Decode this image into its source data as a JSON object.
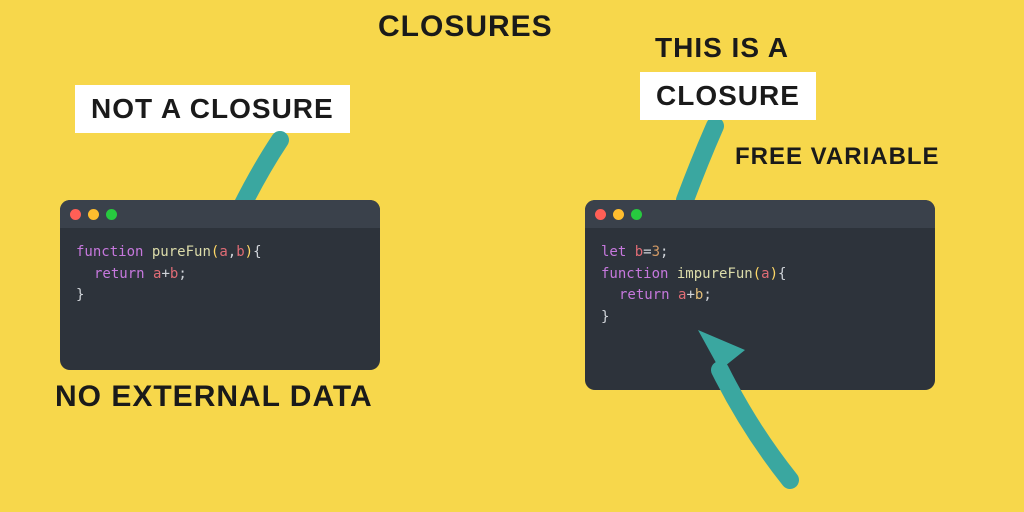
{
  "title": "CLOSURES",
  "left": {
    "label": "NOT A CLOSURE",
    "caption": "NO EXTERNAL DATA",
    "code": {
      "line1_kw": "function",
      "line1_fn": "pureFun",
      "line1_paren_open": "(",
      "line1_args_a": "a",
      "line1_args_comma": ",",
      "line1_args_b": "b",
      "line1_paren_close": ")",
      "line1_brace": "{",
      "line2_kw": "return",
      "line2_a": "a",
      "line2_plus": "+",
      "line2_b": "b",
      "line2_semi": ";",
      "line3_brace": "}"
    }
  },
  "right": {
    "label_top": "THIS IS A",
    "label_bottom": "CLOSURE",
    "caption": "FREE VARIABLE",
    "code": {
      "line1_kw": "let",
      "line1_var": "b",
      "line1_eq": "=",
      "line1_num": "3",
      "line1_semi": ";",
      "line2_kw": "function",
      "line2_fn": "impureFun",
      "line2_paren_open": "(",
      "line2_args_a": "a",
      "line2_paren_close": ")",
      "line2_brace": "{",
      "line3_kw": "return",
      "line3_a": "a",
      "line3_plus": "+",
      "line3_b": "b",
      "line3_semi": ";",
      "line4_brace": "}"
    }
  },
  "colors": {
    "arrow": "#3aa7a0"
  }
}
